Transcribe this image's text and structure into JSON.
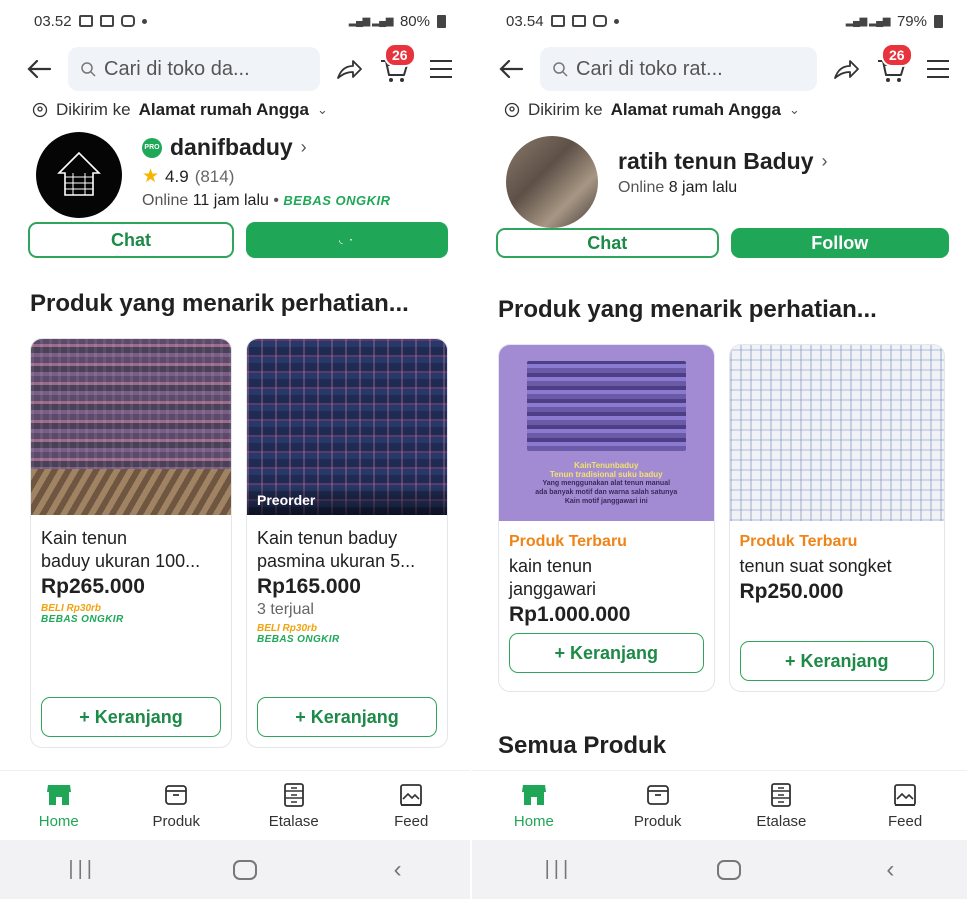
{
  "colors": {
    "accent": "#1fa657",
    "badge": "#e8323c",
    "promo_orange": "#ef8418"
  },
  "left": {
    "status": {
      "time": "03.52",
      "battery": "80%"
    },
    "search": {
      "placeholder": "Cari di toko da..."
    },
    "cart_count": "26",
    "shipto": {
      "prefix": "Dikirim ke",
      "address": "Alamat rumah Angga"
    },
    "shop": {
      "name": "danifbaduy",
      "badge": "PRO",
      "rating": "4.9",
      "reviews": "(814)",
      "online_prefix": "Online",
      "online_value": "11 jam lalu",
      "dot": "•",
      "free_shipping": "BEBAS ONGKIR"
    },
    "buttons": {
      "chat": "Chat",
      "follow": ""
    },
    "section_title": "Produk yang menarik perhatian...",
    "products": [
      {
        "name": "Kain tenun baduy ukuran 100...",
        "name_line1": "Kain tenun",
        "name_line2": "baduy ukuran 100...",
        "price": "Rp265.000",
        "sold": "",
        "promo1": "BELI Rp30rb",
        "promo2": "BEBAS ONGKIR",
        "badge": "",
        "cart": "+ Keranjang"
      },
      {
        "name": "Kain tenun baduy pasmina ukuran 5...",
        "name_line1": "Kain tenun baduy",
        "name_line2": "pasmina ukuran 5...",
        "price": "Rp165.000",
        "sold": "3 terjual",
        "promo1": "BELI Rp30rb",
        "promo2": "BEBAS ONGKIR",
        "badge": "Preorder",
        "cart": "+ Keranjang"
      }
    ],
    "nav": [
      "Home",
      "Produk",
      "Etalase",
      "Feed"
    ]
  },
  "right": {
    "status": {
      "time": "03.54",
      "battery": "79%"
    },
    "search": {
      "placeholder": "Cari di toko rat..."
    },
    "cart_count": "26",
    "shipto": {
      "prefix": "Dikirim ke",
      "address": "Alamat rumah Angga"
    },
    "shop": {
      "name": "ratih tenun Baduy",
      "online_prefix": "Online",
      "online_value": "8 jam lalu"
    },
    "buttons": {
      "chat": "Chat",
      "follow": "Follow"
    },
    "section_title": "Produk yang menarik perhatian...",
    "products": [
      {
        "tag": "Produk Terbaru",
        "name_line1": "kain tenun",
        "name_line2": "janggawari",
        "price": "Rp1.000.000",
        "cart": "+ Keranjang",
        "img_title": "KainTenunbaduy",
        "img_sub": "Tenun tradisional suku baduy",
        "img_line1": "Yang menggunakan alat tenun manual",
        "img_line2": "ada banyak motif dan warna salah satunya",
        "img_line3": "Kain motif janggawari ini"
      },
      {
        "tag": "Produk Terbaru",
        "name_line1": "tenun suat songket",
        "price": "Rp250.000",
        "cart": "+ Keranjang"
      }
    ],
    "all_products": "Semua Produk",
    "nav": [
      "Home",
      "Produk",
      "Etalase",
      "Feed"
    ]
  }
}
